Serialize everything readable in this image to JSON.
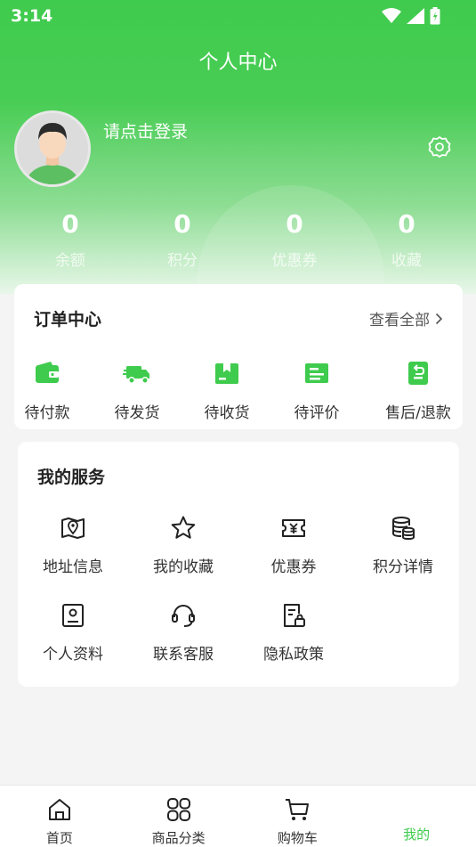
{
  "status_bar": {
    "time": "3:14"
  },
  "header": {
    "title": "个人中心"
  },
  "profile": {
    "login_prompt": "请点击登录"
  },
  "stats": [
    {
      "value": "0",
      "label": "余额"
    },
    {
      "value": "0",
      "label": "积分"
    },
    {
      "value": "0",
      "label": "优惠券"
    },
    {
      "value": "0",
      "label": "收藏"
    }
  ],
  "orders": {
    "title": "订单中心",
    "view_all": "查看全部",
    "items": [
      {
        "label": "待付款",
        "icon": "wallet-icon"
      },
      {
        "label": "待发货",
        "icon": "truck-icon"
      },
      {
        "label": "待收货",
        "icon": "package-icon"
      },
      {
        "label": "待评价",
        "icon": "review-icon"
      },
      {
        "label": "售后/退款",
        "icon": "refund-icon"
      }
    ]
  },
  "services": {
    "title": "我的服务",
    "items": [
      {
        "label": "地址信息",
        "icon": "map-icon"
      },
      {
        "label": "我的收藏",
        "icon": "star-icon"
      },
      {
        "label": "优惠券",
        "icon": "coupon-icon"
      },
      {
        "label": "积分详情",
        "icon": "coins-icon"
      },
      {
        "label": "个人资料",
        "icon": "profile-card-icon"
      },
      {
        "label": "联系客服",
        "icon": "headset-icon"
      },
      {
        "label": "隐私政策",
        "icon": "policy-lock-icon"
      }
    ]
  },
  "tabbar": {
    "items": [
      {
        "label": "首页",
        "icon": "home-icon"
      },
      {
        "label": "商品分类",
        "icon": "grid-icon"
      },
      {
        "label": "购物车",
        "icon": "cart-icon"
      },
      {
        "label": "我的",
        "icon": "me-icon",
        "active": true
      }
    ]
  },
  "colors": {
    "brand": "#3fcb4d"
  }
}
